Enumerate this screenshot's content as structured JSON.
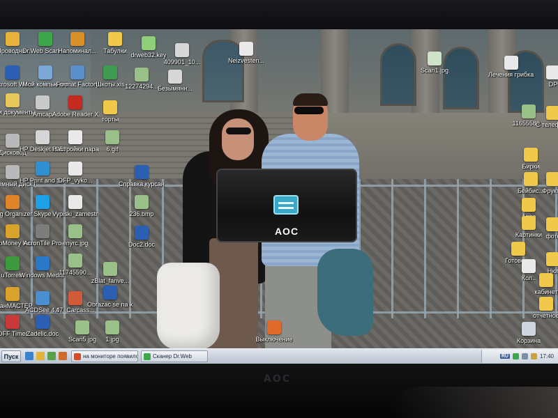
{
  "desktop": {
    "icons": [
      {
        "label": "Проводник",
        "icon": "folder-explorer-icon",
        "color": "#e8b13a"
      },
      {
        "label": "Dr.Web Scanner",
        "icon": "drweb-icon",
        "color": "#3da84a"
      },
      {
        "label": "Напоминал...",
        "icon": "reminder-icon",
        "color": "#d9902a"
      },
      {
        "label": "Табулки",
        "icon": "folder-icon",
        "color": "#f0c94a"
      },
      {
        "label": "drweb32.key",
        "icon": "key-file-icon",
        "color": "#8fcf7a"
      },
      {
        "label": "409901_10...",
        "icon": "image-file-icon",
        "color": "#d7d7d7"
      },
      {
        "label": "Neizvesten...",
        "icon": "document-icon",
        "color": "#e9e9e9"
      },
      {
        "label": "Scan1.jpg",
        "icon": "image-file-icon",
        "color": "#cfe3c8"
      },
      {
        "label": "Лечения грибка ног ...",
        "icon": "document-icon",
        "color": "#e9e9e9"
      },
      {
        "label": "DP",
        "icon": "document-icon",
        "color": "#e9e9e9"
      },
      {
        "label": "Microsoft Word",
        "icon": "word-icon",
        "color": "#2b5fb4"
      },
      {
        "label": "Мой компьютер",
        "icon": "my-computer-icon",
        "color": "#7aa6d8"
      },
      {
        "label": "Format Factory",
        "icon": "format-factory-icon",
        "color": "#5b8fc9"
      },
      {
        "label": "Шкоты.xls",
        "icon": "excel-file-icon",
        "color": "#3f9b4f"
      },
      {
        "label": "12274294...",
        "icon": "image-file-icon",
        "color": "#9ac08a"
      },
      {
        "label": "Безымянн...",
        "icon": "image-file-icon",
        "color": "#d7d7d7"
      },
      {
        "label": "Мои документы",
        "icon": "my-documents-icon",
        "color": "#e8c85a"
      },
      {
        "label": "Аmcap",
        "icon": "camera-icon",
        "color": "#c9c9c9"
      },
      {
        "label": "Adobe Reader XI",
        "icon": "pdf-icon",
        "color": "#c42a1f"
      },
      {
        "label": "торты",
        "icon": "folder-icon",
        "color": "#f0c94a"
      },
      {
        "label": "11655589...",
        "icon": "image-file-icon",
        "color": "#9ac08a"
      },
      {
        "label": "С телефона",
        "icon": "folder-icon",
        "color": "#f0c94a"
      },
      {
        "label": "Дисковод",
        "icon": "disk-drive-icon",
        "color": "#b9b9b9"
      },
      {
        "label": "HP Deskjet 2050 J5...",
        "icon": "printer-icon",
        "color": "#d6d6d6"
      },
      {
        "label": "Настройки параметров...",
        "icon": "document-icon",
        "color": "#e9e9e9"
      },
      {
        "label": "6.gif",
        "icon": "image-file-icon",
        "color": "#9ac08a"
      },
      {
        "label": "Бирки",
        "icon": "folder-icon",
        "color": "#f0c94a"
      },
      {
        "label": "Съемный диск (D)",
        "icon": "removable-disk-icon",
        "color": "#b9b9b9"
      },
      {
        "label": "HP Print and Scan Doctor",
        "icon": "hp-doctor-icon",
        "color": "#2f8fd1"
      },
      {
        "label": "DFP_vyko...",
        "icon": "document-icon",
        "color": "#e9e9e9"
      },
      {
        "label": "Справка курсант3...",
        "icon": "word-file-icon",
        "color": "#2b5fb4"
      },
      {
        "label": "Бейбис...",
        "icon": "folder-icon",
        "color": "#f0c94a"
      },
      {
        "label": "Фрукты",
        "icon": "folder-icon",
        "color": "#f0c94a"
      },
      {
        "label": "Img Organizer",
        "icon": "organizer-icon",
        "color": "#e0842a"
      },
      {
        "label": "Skype",
        "icon": "skype-icon",
        "color": "#1ea0e6"
      },
      {
        "label": "Vypiski_zamestnane...",
        "icon": "document-icon",
        "color": "#e9e9e9"
      },
      {
        "label": "236.bmp",
        "icon": "image-file-icon",
        "color": "#9ac08a"
      },
      {
        "label": "Арве",
        "icon": "folder-icon",
        "color": "#f0c94a"
      },
      {
        "label": "Картинки",
        "icon": "folder-icon",
        "color": "#f0c94a"
      },
      {
        "label": "фото",
        "icon": "folder-icon",
        "color": "#f0c94a"
      },
      {
        "label": "WebMoney Keeper Cl...",
        "icon": "webmoney-icon",
        "color": "#d9a22a"
      },
      {
        "label": "AcronTile Pro",
        "icon": "acron-icon",
        "color": "#7d7d7d"
      },
      {
        "label": "enyrc.jpg",
        "icon": "image-file-icon",
        "color": "#9ac08a"
      },
      {
        "label": "Doc2.doc",
        "icon": "word-file-icon",
        "color": "#2b5fb4"
      },
      {
        "label": "Готово ...",
        "icon": "folder-icon",
        "color": "#f0c94a"
      },
      {
        "label": "Кол..",
        "icon": "document-icon",
        "color": "#e9e9e9"
      },
      {
        "label": "Нюг",
        "icon": "folder-icon",
        "color": "#f0c94a"
      },
      {
        "label": "uTorrent",
        "icon": "utorrent-icon",
        "color": "#3c9a3c"
      },
      {
        "label": "Windows Media Player",
        "icon": "media-player-icon",
        "color": "#2b78c8"
      },
      {
        "label": "11745590...",
        "icon": "image-file-icon",
        "color": "#9ac08a"
      },
      {
        "label": "zBlat_fanve...",
        "icon": "image-file-icon",
        "color": "#9ac08a"
      },
      {
        "label": "кабинет",
        "icon": "folder-icon",
        "color": "#f0c94a"
      },
      {
        "label": "отчетное",
        "icon": "folder-icon",
        "color": "#f0c94a"
      },
      {
        "label": "СканМАСТЕР",
        "icon": "scanmaster-icon",
        "color": "#d9a22a"
      },
      {
        "label": "ACDSee 4.0",
        "icon": "acdsee-icon",
        "color": "#4a8fd0"
      },
      {
        "label": "47_Carcass...",
        "icon": "image-file-icon",
        "color": "#d05a3a"
      },
      {
        "label": "Obrazac se na katidno.doc",
        "icon": "word-file-icon",
        "color": "#2b5fb4"
      },
      {
        "label": "OFF Timer",
        "icon": "off-timer-icon",
        "color": "#c83a3a"
      },
      {
        "label": "Zadelic.doc",
        "icon": "word-file-icon",
        "color": "#2b5fb4"
      },
      {
        "label": "Scan5.jpg",
        "icon": "image-file-icon",
        "color": "#9ac08a"
      },
      {
        "label": "1.jpg",
        "icon": "image-file-icon",
        "color": "#9ac08a"
      },
      {
        "label": "Выключение",
        "icon": "shutdown-icon",
        "color": "#e06a2a"
      },
      {
        "label": "Корзина",
        "icon": "recycle-bin-icon",
        "color": "#cfd6df"
      }
    ]
  },
  "osd": {
    "brand": "AOC",
    "icon": "monitor-menu-icon",
    "accent": "#3aa9c8"
  },
  "bezel": {
    "logo": "AOC"
  },
  "taskbar": {
    "start_label": "Пуск",
    "quick_launch": [
      "ie-icon",
      "explorer-icon",
      "media-icon",
      "firefox-icon"
    ],
    "buttons": [
      {
        "label": "на мониторе появился ...",
        "icon": "browser-icon",
        "color": "#d44b2a"
      },
      {
        "label": "Сканер Dr.Web",
        "icon": "drweb-icon",
        "color": "#3da84a"
      }
    ],
    "tray": {
      "lang": "RU",
      "clock": "17:40"
    }
  }
}
